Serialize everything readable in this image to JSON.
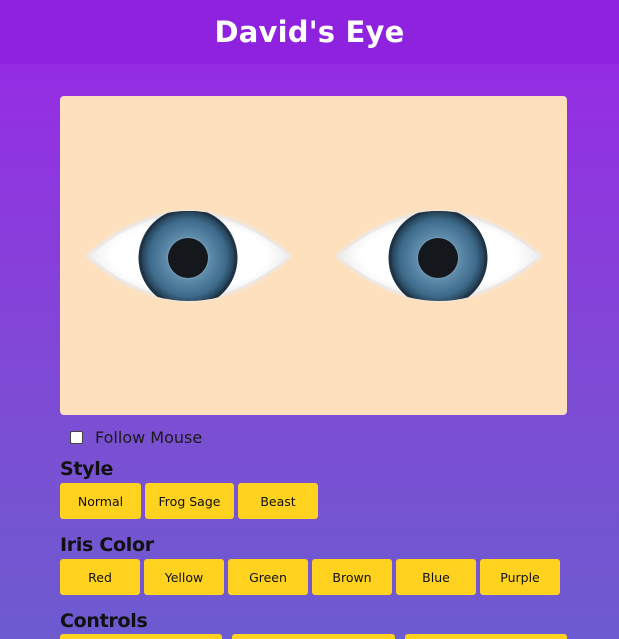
{
  "header": {
    "title": "David's Eye"
  },
  "eyes": {
    "background_color": "#ffe0bd",
    "iris_color": "#3d6a8a",
    "pupil_color": "#14181c",
    "sclera_color": "#ffffff"
  },
  "follow_mouse": {
    "label": "Follow Mouse",
    "checked": false
  },
  "style_section": {
    "title": "Style",
    "buttons": [
      "Normal",
      "Frog Sage",
      "Beast"
    ]
  },
  "iris_section": {
    "title": "Iris Color",
    "buttons": [
      "Red",
      "Yellow",
      "Green",
      "Brown",
      "Blue",
      "Purple"
    ]
  },
  "controls_section": {
    "title": "Controls"
  },
  "colors": {
    "header_bg": "#8f22df",
    "button_bg": "#ffd21f",
    "page_gradient_top": "#9a26e6",
    "page_gradient_bottom": "#6d5bd0"
  }
}
